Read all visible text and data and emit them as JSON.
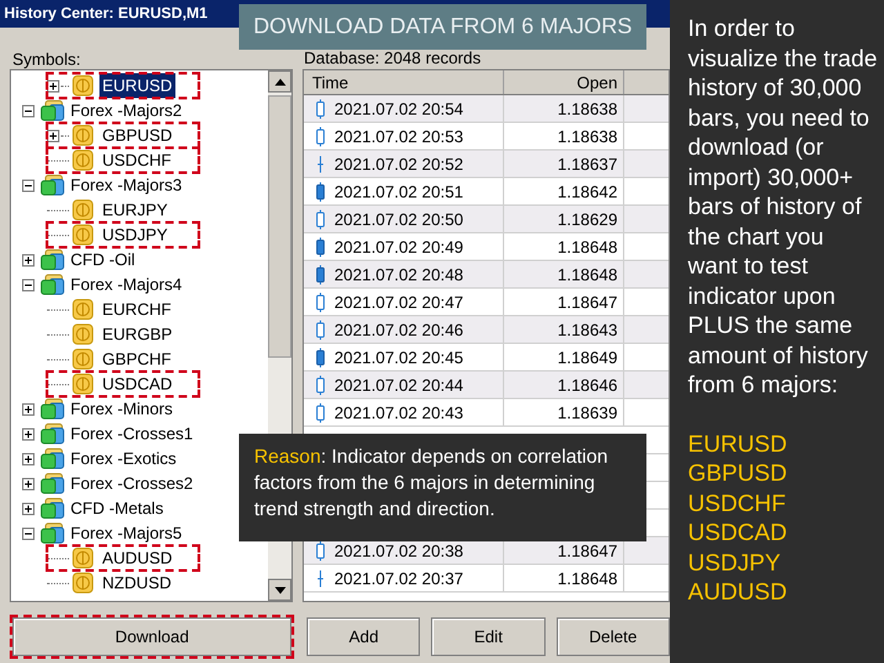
{
  "window": {
    "title": "History Center: EURUSD,M1"
  },
  "banner": "DOWNLOAD DATA FROM 6 MAJORS",
  "symbols_label": "Symbols:",
  "tree": [
    {
      "kind": "symbol",
      "label": "EURUSD",
      "expandable": true,
      "selected": true,
      "highlighted": true
    },
    {
      "kind": "group",
      "label": "Forex -Majors2",
      "expanded": true,
      "children": [
        {
          "kind": "symbol",
          "label": "GBPUSD",
          "expandable": true,
          "selected": false,
          "highlighted": true
        },
        {
          "kind": "symbol",
          "label": "USDCHF",
          "expandable": false,
          "selected": false,
          "highlighted": true
        }
      ]
    },
    {
      "kind": "group",
      "label": "Forex -Majors3",
      "expanded": true,
      "children": [
        {
          "kind": "symbol",
          "label": "EURJPY",
          "expandable": false,
          "selected": false,
          "highlighted": false
        },
        {
          "kind": "symbol",
          "label": "USDJPY",
          "expandable": false,
          "selected": false,
          "highlighted": true
        }
      ]
    },
    {
      "kind": "group",
      "label": "CFD -Oil",
      "expanded": false
    },
    {
      "kind": "group",
      "label": "Forex -Majors4",
      "expanded": true,
      "children": [
        {
          "kind": "symbol",
          "label": "EURCHF",
          "expandable": false,
          "selected": false,
          "highlighted": false
        },
        {
          "kind": "symbol",
          "label": "EURGBP",
          "expandable": false,
          "selected": false,
          "highlighted": false
        },
        {
          "kind": "symbol",
          "label": "GBPCHF",
          "expandable": false,
          "selected": false,
          "highlighted": false
        },
        {
          "kind": "symbol",
          "label": "USDCAD",
          "expandable": false,
          "selected": false,
          "highlighted": true
        }
      ]
    },
    {
      "kind": "group",
      "label": "Forex -Minors",
      "expanded": false
    },
    {
      "kind": "group",
      "label": "Forex -Crosses1",
      "expanded": false
    },
    {
      "kind": "group",
      "label": "Forex -Exotics",
      "expanded": false
    },
    {
      "kind": "group",
      "label": "Forex -Crosses2",
      "expanded": false
    },
    {
      "kind": "group",
      "label": "CFD -Metals",
      "expanded": false
    },
    {
      "kind": "group",
      "label": "Forex -Majors5",
      "expanded": true,
      "children": [
        {
          "kind": "symbol",
          "label": "AUDUSD",
          "expandable": false,
          "selected": false,
          "highlighted": true
        },
        {
          "kind": "symbol",
          "label": "NZDUSD",
          "expandable": false,
          "selected": false,
          "highlighted": false
        }
      ]
    }
  ],
  "database": "Database: 2048 records",
  "table": {
    "columns": [
      "Time",
      "Open"
    ],
    "rows": [
      {
        "kind": "bull",
        "time": "2021.07.02 20:54",
        "open": "1.18638"
      },
      {
        "kind": "bull",
        "time": "2021.07.02 20:53",
        "open": "1.18638"
      },
      {
        "kind": "doji",
        "time": "2021.07.02 20:52",
        "open": "1.18637"
      },
      {
        "kind": "bear",
        "time": "2021.07.02 20:51",
        "open": "1.18642"
      },
      {
        "kind": "bull",
        "time": "2021.07.02 20:50",
        "open": "1.18629"
      },
      {
        "kind": "bear",
        "time": "2021.07.02 20:49",
        "open": "1.18648"
      },
      {
        "kind": "bear",
        "time": "2021.07.02 20:48",
        "open": "1.18648"
      },
      {
        "kind": "bull",
        "time": "2021.07.02 20:47",
        "open": "1.18647"
      },
      {
        "kind": "bull",
        "time": "2021.07.02 20:46",
        "open": "1.18643"
      },
      {
        "kind": "bear",
        "time": "2021.07.02 20:45",
        "open": "1.18649"
      },
      {
        "kind": "bull",
        "time": "2021.07.02 20:44",
        "open": "1.18646"
      },
      {
        "kind": "bull",
        "time": "2021.07.02 20:43",
        "open": "1.18639"
      }
    ],
    "rows_after": [
      {
        "kind": "bull",
        "time": "2021.07.02 20:38",
        "open": "1.18647"
      },
      {
        "kind": "doji",
        "time": "2021.07.02 20:37",
        "open": "1.18648"
      }
    ]
  },
  "reason": {
    "label": "Reason",
    "text": ": Indicator depends on correlation factors from the 6 majors in determining trend strength and direction."
  },
  "buttons": [
    {
      "label": "Download",
      "highlighted": true
    },
    {
      "label": "Add",
      "highlighted": false
    },
    {
      "label": "Edit",
      "highlighted": false
    },
    {
      "label": "Delete",
      "highlighted": false
    }
  ],
  "side": {
    "text": "In order to visualize the trade history of 30,000 bars, you need to download (or import) 30,000+ bars of history of the chart you want to test indicator upon PLUS the same amount of history from 6 majors:",
    "majors": [
      "EURUSD",
      "GBPUSD",
      "USDCHF",
      "USDCAD",
      "USDJPY",
      "AUDUSD"
    ]
  }
}
